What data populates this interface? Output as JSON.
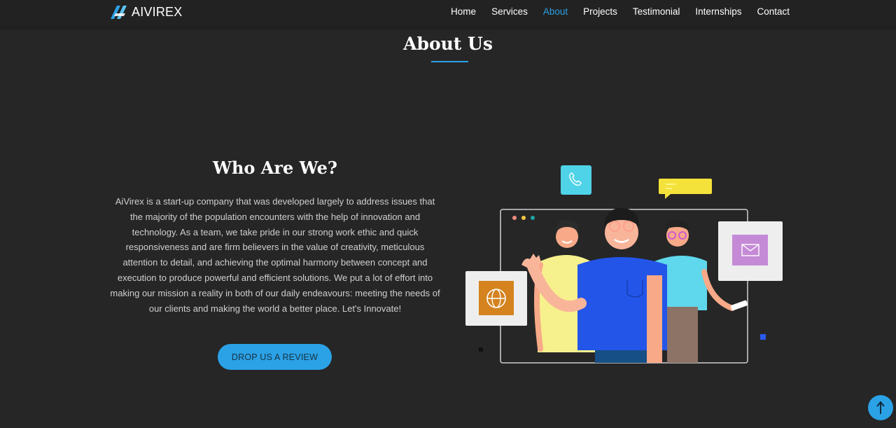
{
  "brand": {
    "name": "AIVIREX",
    "logo_icon": "aivirex-logo-icon"
  },
  "nav": {
    "items": [
      {
        "label": "Home",
        "active": false
      },
      {
        "label": "Services",
        "active": false
      },
      {
        "label": "About",
        "active": true
      },
      {
        "label": "Projects",
        "active": false
      },
      {
        "label": "Testimonial",
        "active": false
      },
      {
        "label": "Internships",
        "active": false
      },
      {
        "label": "Contact",
        "active": false
      }
    ]
  },
  "section": {
    "title": "About Us"
  },
  "about": {
    "heading": "Who Are We?",
    "body": "AiVirex is a start-up company that was developed largely to address issues that the majority of the population encounters with the help of innovation and technology. As a team, we take pride in our strong work ethic and quick responsiveness and are firm believers in the value of creativity, meticulous attention to detail, and achieving the optimal harmony between concept and execution to produce powerful and efficient solutions. We put a lot of effort into making our mission a reality in both of our daily endeavours: meeting the needs of our clients and making the world a better place. Let's Innovate!",
    "cta_label": "DROP US A REVIEW"
  },
  "scroll_top": {
    "icon": "arrow-up-icon"
  },
  "colors": {
    "accent": "#2ba1e6",
    "background": "#262626",
    "header": "#222222"
  }
}
